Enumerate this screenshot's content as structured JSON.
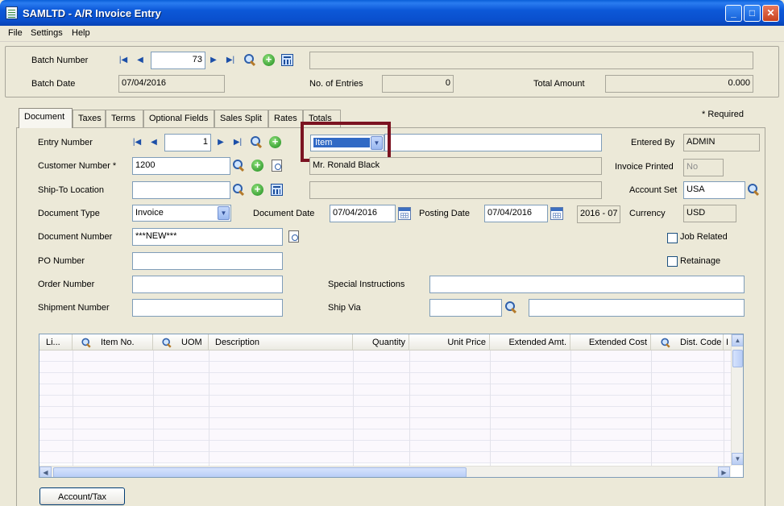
{
  "window": {
    "title": "SAMLTD - A/R Invoice Entry",
    "min_label": "_",
    "max_label": "□",
    "close_label": "✕"
  },
  "menu": {
    "file": "File",
    "settings": "Settings",
    "help": "Help"
  },
  "batch": {
    "number_label": "Batch Number",
    "number_value": "73",
    "description_value": "",
    "date_label": "Batch Date",
    "date_value": "07/04/2016",
    "entries_label": "No. of Entries",
    "entries_value": "0",
    "total_label": "Total Amount",
    "total_value": "0.000"
  },
  "required_note": "*  Required",
  "tabs": [
    {
      "label": "Document"
    },
    {
      "label": "Taxes"
    },
    {
      "label": "Terms"
    },
    {
      "label": "Optional Fields"
    },
    {
      "label": "Sales Split"
    },
    {
      "label": "Rates"
    },
    {
      "label": "Totals"
    }
  ],
  "document": {
    "entry_number_label": "Entry Number",
    "entry_number_value": "1",
    "entry_type_value": "Item",
    "entry_description_value": "",
    "entered_by_label": "Entered By",
    "entered_by_value": "ADMIN",
    "customer_number_label": "Customer Number *",
    "customer_number_value": "1200",
    "customer_name_value": "Mr. Ronald Black",
    "invoice_printed_label": "Invoice Printed",
    "invoice_printed_value": "No",
    "ship_to_label": "Ship-To Location",
    "ship_to_value": "",
    "ship_to_desc_value": "",
    "account_set_label": "Account Set",
    "account_set_value": "USA",
    "document_type_label": "Document Type",
    "document_type_value": "Invoice",
    "document_date_label": "Document Date",
    "document_date_value": "07/04/2016",
    "posting_date_label": "Posting Date",
    "posting_date_value": "07/04/2016",
    "period_value": "2016 - 07",
    "currency_label": "Currency",
    "currency_value": "USD",
    "document_number_label": "Document Number",
    "document_number_value": "***NEW***",
    "job_related_label": "Job Related",
    "po_number_label": "PO Number",
    "po_number_value": "",
    "retainage_label": "Retainage",
    "order_number_label": "Order Number",
    "order_number_value": "",
    "special_instructions_label": "Special Instructions",
    "special_instructions_value": "",
    "shipment_number_label": "Shipment Number",
    "shipment_number_value": "",
    "ship_via_label": "Ship Via",
    "ship_via_code_value": "",
    "ship_via_desc_value": ""
  },
  "grid": {
    "columns": [
      "Li...",
      "Item No.",
      "UOM",
      "Description",
      "Quantity",
      "Unit Price",
      "Extended Amt.",
      "Extended Cost",
      "Dist. Code",
      "I"
    ],
    "rows": []
  },
  "buttons": {
    "account_tax": "Account/Tax"
  },
  "icons": [
    "first-icon",
    "prev-icon",
    "next-icon",
    "last-icon",
    "search-icon",
    "add-icon",
    "calculator-icon",
    "drilldown-icon",
    "calendar-icon"
  ]
}
